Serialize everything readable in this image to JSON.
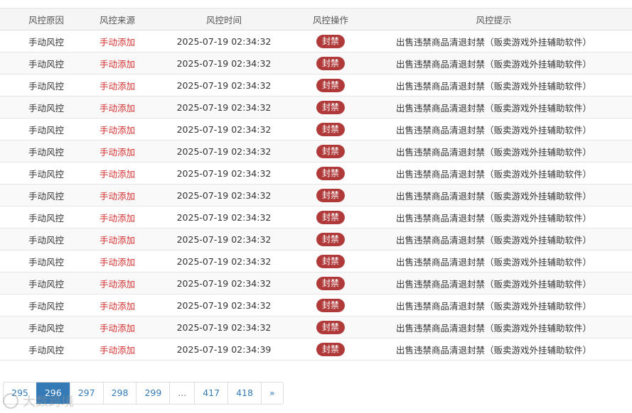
{
  "table": {
    "headers": [
      "风控原因",
      "风控来源",
      "风控时间",
      "风控操作",
      "风控提示"
    ],
    "rows": [
      {
        "reason": "手动风控",
        "source": "手动添加",
        "time": "2025-07-19 02:34:32",
        "action": "封禁",
        "hint": "出售违禁商品清退封禁（贩卖游戏外挂辅助软件）"
      },
      {
        "reason": "手动风控",
        "source": "手动添加",
        "time": "2025-07-19 02:34:32",
        "action": "封禁",
        "hint": "出售违禁商品清退封禁（贩卖游戏外挂辅助软件）"
      },
      {
        "reason": "手动风控",
        "source": "手动添加",
        "time": "2025-07-19 02:34:32",
        "action": "封禁",
        "hint": "出售违禁商品清退封禁（贩卖游戏外挂辅助软件）"
      },
      {
        "reason": "手动风控",
        "source": "手动添加",
        "time": "2025-07-19 02:34:32",
        "action": "封禁",
        "hint": "出售违禁商品清退封禁（贩卖游戏外挂辅助软件）"
      },
      {
        "reason": "手动风控",
        "source": "手动添加",
        "time": "2025-07-19 02:34:32",
        "action": "封禁",
        "hint": "出售违禁商品清退封禁（贩卖游戏外挂辅助软件）"
      },
      {
        "reason": "手动风控",
        "source": "手动添加",
        "time": "2025-07-19 02:34:32",
        "action": "封禁",
        "hint": "出售违禁商品清退封禁（贩卖游戏外挂辅助软件）"
      },
      {
        "reason": "手动风控",
        "source": "手动添加",
        "time": "2025-07-19 02:34:32",
        "action": "封禁",
        "hint": "出售违禁商品清退封禁（贩卖游戏外挂辅助软件）"
      },
      {
        "reason": "手动风控",
        "source": "手动添加",
        "time": "2025-07-19 02:34:32",
        "action": "封禁",
        "hint": "出售违禁商品清退封禁（贩卖游戏外挂辅助软件）"
      },
      {
        "reason": "手动风控",
        "source": "手动添加",
        "time": "2025-07-19 02:34:32",
        "action": "封禁",
        "hint": "出售违禁商品清退封禁（贩卖游戏外挂辅助软件）"
      },
      {
        "reason": "手动风控",
        "source": "手动添加",
        "time": "2025-07-19 02:34:32",
        "action": "封禁",
        "hint": "出售违禁商品清退封禁（贩卖游戏外挂辅助软件）"
      },
      {
        "reason": "手动风控",
        "source": "手动添加",
        "time": "2025-07-19 02:34:32",
        "action": "封禁",
        "hint": "出售违禁商品清退封禁（贩卖游戏外挂辅助软件）"
      },
      {
        "reason": "手动风控",
        "source": "手动添加",
        "time": "2025-07-19 02:34:32",
        "action": "封禁",
        "hint": "出售违禁商品清退封禁（贩卖游戏外挂辅助软件）"
      },
      {
        "reason": "手动风控",
        "source": "手动添加",
        "time": "2025-07-19 02:34:32",
        "action": "封禁",
        "hint": "出售违禁商品清退封禁（贩卖游戏外挂辅助软件）"
      },
      {
        "reason": "手动风控",
        "source": "手动添加",
        "time": "2025-07-19 02:34:32",
        "action": "封禁",
        "hint": "出售违禁商品清退封禁（贩卖游戏外挂辅助软件）"
      },
      {
        "reason": "手动风控",
        "source": "手动添加",
        "time": "2025-07-19 02:34:39",
        "action": "封禁",
        "hint": "出售违禁商品清退封禁（贩卖游戏外挂辅助软件）"
      }
    ]
  },
  "pagination": {
    "items": [
      {
        "label": "295",
        "active": false
      },
      {
        "label": "296",
        "active": true
      },
      {
        "label": "297",
        "active": false
      },
      {
        "label": "298",
        "active": false
      },
      {
        "label": "299",
        "active": false
      },
      {
        "label": "...",
        "active": false
      },
      {
        "label": "417",
        "active": false
      },
      {
        "label": "418",
        "active": false
      },
      {
        "label": "»",
        "active": false
      }
    ]
  },
  "watermark": {
    "text": "大数跨境"
  },
  "colors": {
    "source_red": "#d32f2f",
    "badge_bg": "#b03a3a",
    "active_page": "#337ab7",
    "link": "#337ab7"
  }
}
